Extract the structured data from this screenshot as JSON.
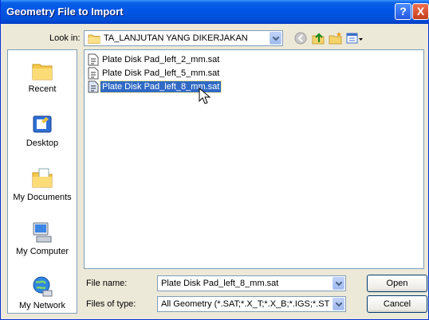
{
  "window": {
    "title": "Geometry File to Import"
  },
  "titlebar": {
    "help_glyph": "?",
    "close_glyph": "X"
  },
  "lookin": {
    "label": "Look in:",
    "value": "TA_LANJUTAN YANG DIKERJAKAN"
  },
  "toolbar_icons": [
    "back-icon",
    "up-folder-icon",
    "new-folder-icon",
    "views-menu-icon"
  ],
  "places": [
    {
      "label": "Recent",
      "icon": "recent-folder-icon"
    },
    {
      "label": "Desktop",
      "icon": "desktop-icon"
    },
    {
      "label": "My Documents",
      "icon": "my-documents-icon"
    },
    {
      "label": "My Computer",
      "icon": "my-computer-icon"
    },
    {
      "label": "My Network",
      "icon": "my-network-icon"
    }
  ],
  "files": [
    {
      "name": "Plate Disk Pad_left_2_mm.sat",
      "selected": false
    },
    {
      "name": "Plate Disk Pad_left_5_mm.sat",
      "selected": false
    },
    {
      "name": "Plate Disk Pad_left_8_mm.sat",
      "selected": true
    }
  ],
  "filename": {
    "label": "File name:",
    "value": "Plate Disk Pad_left_8_mm.sat"
  },
  "filetype": {
    "label": "Files of type:",
    "value": "All Geometry (*.SAT;*.X_T;*.X_B;*.IGS;*.STP;*."
  },
  "buttons": {
    "open": "Open",
    "cancel": "Cancel"
  },
  "colors": {
    "titlebar": "#0055e5",
    "selection": "#316ac5",
    "dialog_bg": "#ece9d8"
  }
}
